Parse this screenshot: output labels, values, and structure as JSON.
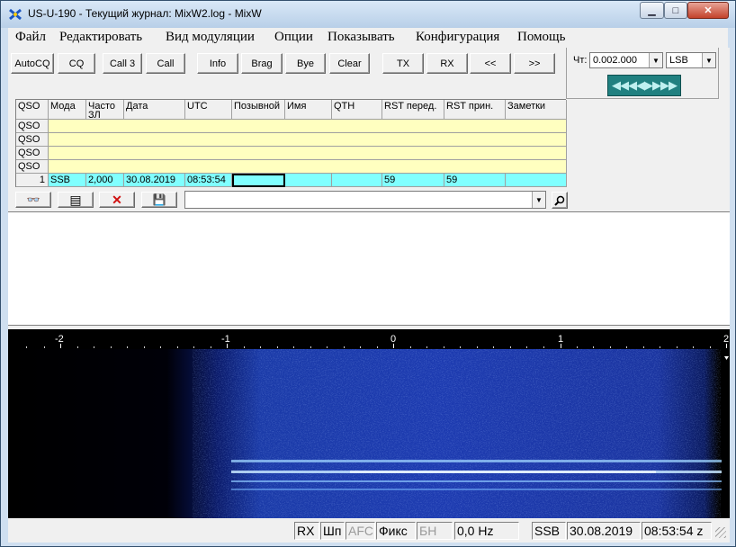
{
  "window": {
    "title": "US-U-190 - Текущий журнал: MixW2.log - MixW",
    "controls": {
      "minimize": "▁",
      "maximize": "□",
      "close": "✕"
    }
  },
  "menu": [
    "Файл",
    "Редактировать",
    "Вид модуляции",
    "Опции",
    "Показывать",
    "Конфигурация",
    "Помощь"
  ],
  "toolbar": {
    "autocq": "AutoCQ",
    "cq": "CQ",
    "call3": "Call 3",
    "call": "Call",
    "info": "Info",
    "brag": "Brag",
    "bye": "Bye",
    "clear": "Clear",
    "tx": "TX",
    "rx": "RX",
    "prev": "<<",
    "next": ">>"
  },
  "right_panel": {
    "freq_label": "Чт:",
    "freq_value": "0.002.000",
    "mode_value": "LSB",
    "tune_glyphs": "◀◀◀◀▶▶▶▶"
  },
  "log_table": {
    "headers": [
      "QSO",
      "Мода",
      "Часто",
      "Дата",
      "UTC",
      "Позывной",
      "Имя",
      "QTH",
      "RST перед.",
      "RST прин.",
      "Заметки"
    ],
    "header_sub": "ЗЛ",
    "prior_rows": [
      "QSO",
      "QSO",
      "QSO",
      "QSO"
    ],
    "current": {
      "num": "1",
      "mode": "SSB",
      "freq": "2,000",
      "date": "30.08.2019",
      "utc": "08:53:54",
      "call": "",
      "name": "",
      "qth": "",
      "rst_sent": "59",
      "rst_rcvd": "59",
      "notes": ""
    }
  },
  "qso_toolbar": {
    "glasses_icon": "👓",
    "list_icon": "▤",
    "delete_icon": "✕",
    "save_icon": "💾",
    "combo_value": ""
  },
  "scale": {
    "labels": [
      "-2",
      "-1",
      "0",
      "1",
      "2"
    ]
  },
  "status": {
    "rx": "RX",
    "shp": "Шп",
    "afc": "AFC",
    "fix": "Фикс",
    "bn": "БН",
    "offset": "0,0 Hz",
    "mode": "SSB",
    "date": "30.08.2019",
    "time": "08:53:54 z"
  },
  "colors": {
    "log_yellow": "#ffffc0",
    "current_row": "#80ffff",
    "tune_bar": "#208080"
  }
}
